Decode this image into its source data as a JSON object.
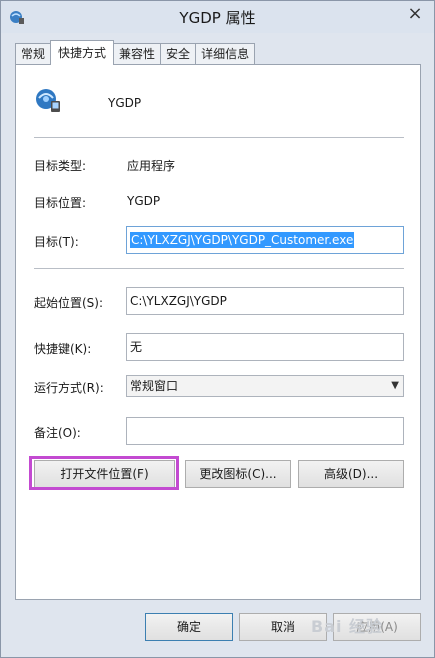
{
  "window": {
    "title": "YGDP 属性",
    "close_glyph": "×",
    "colors": {
      "title_bg": "#dbe3ee",
      "highlight": "#c34ad1",
      "selection": "#3399ff"
    }
  },
  "tabs": [
    {
      "label": "常规"
    },
    {
      "label": "快捷方式"
    },
    {
      "label": "兼容性"
    },
    {
      "label": "安全"
    },
    {
      "label": "详细信息"
    }
  ],
  "shortcut": {
    "app_name": "YGDP",
    "target_type_label": "目标类型:",
    "target_type_value": "应用程序",
    "target_location_label": "目标位置:",
    "target_location_value": "YGDP",
    "target_label": "目标(T):",
    "target_value": "C:\\YLXZGJ\\YGDP\\YGDP_Customer.exe",
    "start_in_label": "起始位置(S):",
    "start_in_value": "C:\\YLXZGJ\\YGDP",
    "hotkey_label": "快捷键(K):",
    "hotkey_value": "无",
    "run_label": "运行方式(R):",
    "run_value": "常规窗口",
    "comment_label": "备注(O):",
    "comment_value": "",
    "open_location_button": "打开文件位置(F)",
    "change_icon_button": "更改图标(C)...",
    "advanced_button": "高级(D)..."
  },
  "dialog_buttons": {
    "ok": "确定",
    "cancel": "取消",
    "apply": "应用(A)"
  },
  "watermark": "Bai 经验"
}
